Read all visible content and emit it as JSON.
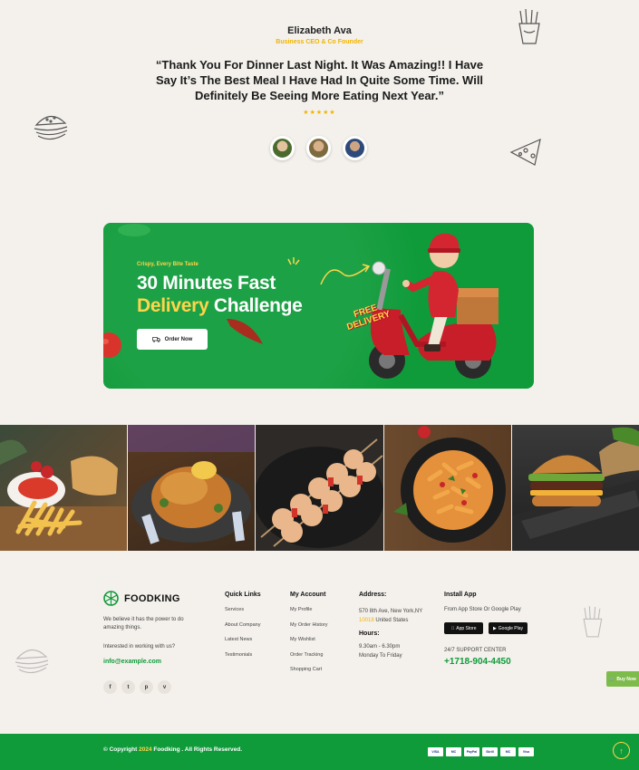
{
  "testimonial": {
    "name": "Elizabeth Ava",
    "role": "Business CEO & Co Founder",
    "quote": "“Thank You For Dinner Last Night. It Was Amazing!! I Have Say It’s The Best Meal I Have Had In Quite Some Time. Will Definitely Be Seeing More Eating Next Year.”",
    "stars": "★★★★★",
    "rating": 5
  },
  "banner": {
    "tagline": "Crispy, Every Bite Taste",
    "title_line1": "30 Minutes Fast",
    "title_highlight": "Delivery",
    "title_rest": " Challenge",
    "button_label": "Order Now",
    "sticker_text": "FREE DELIVERY"
  },
  "gallery": {
    "items": [
      {
        "icon": "fries-wrap-platter"
      },
      {
        "icon": "roast-chicken"
      },
      {
        "icon": "kebab-skewers"
      },
      {
        "icon": "penne-pasta"
      },
      {
        "icon": "burger-board"
      }
    ]
  },
  "footer": {
    "logo_text": "FOODKING",
    "about": "We believe it has the power to do amazing things.",
    "interest": "Interested in working with us?",
    "email": "info@example.com",
    "socials": [
      "f",
      "t",
      "p",
      "v"
    ],
    "quick_links": {
      "heading": "Quick Links",
      "items": [
        "Services",
        "About Company",
        "Latest News",
        "Testimonials"
      ]
    },
    "my_account": {
      "heading": "My Account",
      "items": [
        "My Profile",
        "My Order History",
        "My Wishlist",
        "Order Tracking",
        "Shopping Cart"
      ]
    },
    "address": {
      "heading": "Address:",
      "line1": "570 8th Ave, New York,NY",
      "line2_hl": "10018",
      "line2_rest": " United States",
      "hours_heading": "Hours:",
      "hours_line1": "9.30am - 6.30pm",
      "hours_line2": "Monday To Friday"
    },
    "app": {
      "heading": "Install App",
      "text": "From App Store Or Google Play",
      "app_store": "App Store",
      "google_play": "Google Play",
      "support_label": "24/7 SUPPORT CENTER",
      "phone": "+1718-904-4450"
    },
    "buy_now": "Buy Now"
  },
  "bottom": {
    "copyright_prefix": "© Copyright ",
    "year": "2024",
    "copyright_suffix": " Foodking . All Rights Reserved.",
    "payments": [
      "VISA",
      "MC",
      "PayPal",
      "Skrill",
      "MC",
      "Visa"
    ]
  },
  "colors": {
    "brand_green": "#0f9b3a",
    "accent_yellow": "#f0b400",
    "background": "#f4f1ec"
  }
}
